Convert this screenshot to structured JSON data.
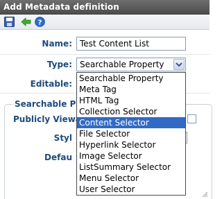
{
  "window": {
    "title": "Add Metadata definition"
  },
  "toolbar": {
    "icons": [
      "save-icon",
      "back-arrow-icon",
      "help-icon"
    ]
  },
  "form": {
    "name_label": "Name:",
    "name_value": "Test Content List",
    "type_label": "Type:",
    "type_selected": "Searchable Property",
    "editable_label": "Editable:",
    "section_legend": "Searchable Pro",
    "publicly_viewable_label": "Publicly Viewab",
    "style_label": "Styl",
    "default_label": "Defau"
  },
  "dropdown": {
    "options": [
      "Searchable Property",
      "Meta Tag",
      "HTML Tag",
      "Collection Selector",
      "Content Selector",
      "File Selector",
      "Hyperlink Selector",
      "Image Selector",
      "ListSummary Selector",
      "Menu Selector",
      "User Selector"
    ],
    "highlighted": "Content Selector"
  },
  "colors": {
    "titlebar": "#575757",
    "label": "#1e4a7c",
    "highlight": "#316ac5"
  }
}
